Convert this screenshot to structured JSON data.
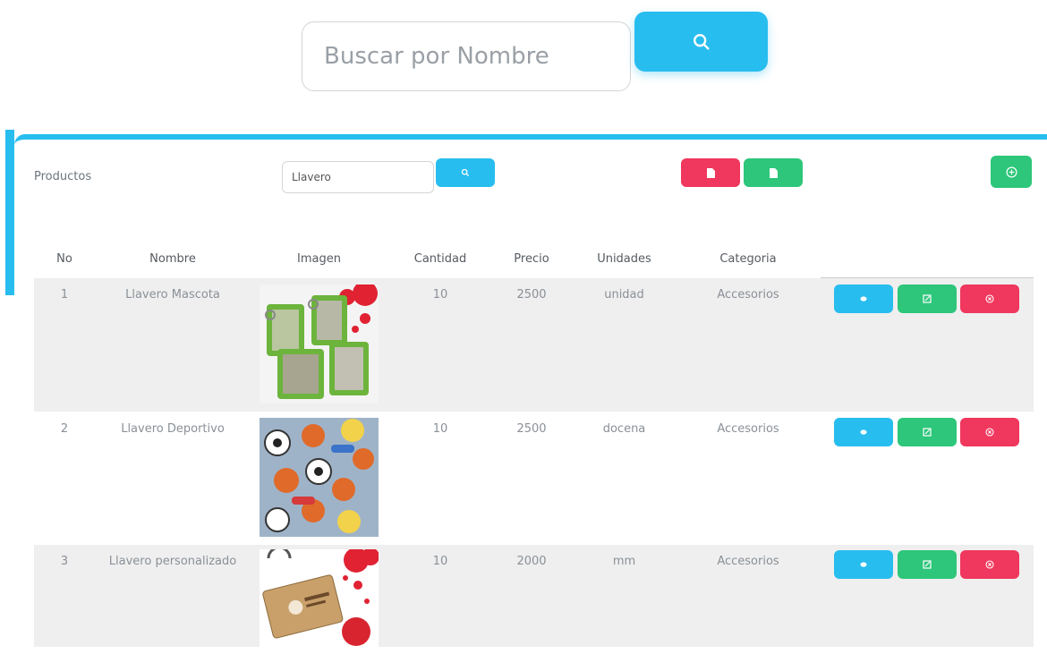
{
  "search": {
    "placeholder": "Buscar por Nombre",
    "icon": "search-icon"
  },
  "card": {
    "title": "Productos",
    "filter_value": "Llavero",
    "buttons": {
      "pdf": "file-pdf-icon",
      "excel": "file-excel-icon",
      "add": "plus-circle-icon"
    }
  },
  "table": {
    "columns": [
      "No",
      "Nombre",
      "Imagen",
      "Cantidad",
      "Precio",
      "Unidades",
      "Categoria"
    ],
    "rows": [
      {
        "no": "1",
        "nombre": "Llavero Mascota",
        "cantidad": "10",
        "precio": "2500",
        "unidades": "unidad",
        "categoria": "Accesorios"
      },
      {
        "no": "2",
        "nombre": "Llavero Deportivo",
        "cantidad": "10",
        "precio": "2500",
        "unidades": "docena",
        "categoria": "Accesorios"
      },
      {
        "no": "3",
        "nombre": "Llavero personalizado",
        "cantidad": "10",
        "precio": "2000",
        "unidades": "mm",
        "categoria": "Accesorios"
      }
    ],
    "row_actions": [
      "eye-icon",
      "edit-icon",
      "x-circle-icon"
    ]
  },
  "colors": {
    "primary": "#28bdef",
    "danger": "#f0375d",
    "success": "#2dc67a",
    "row_bg": "#efefef"
  }
}
